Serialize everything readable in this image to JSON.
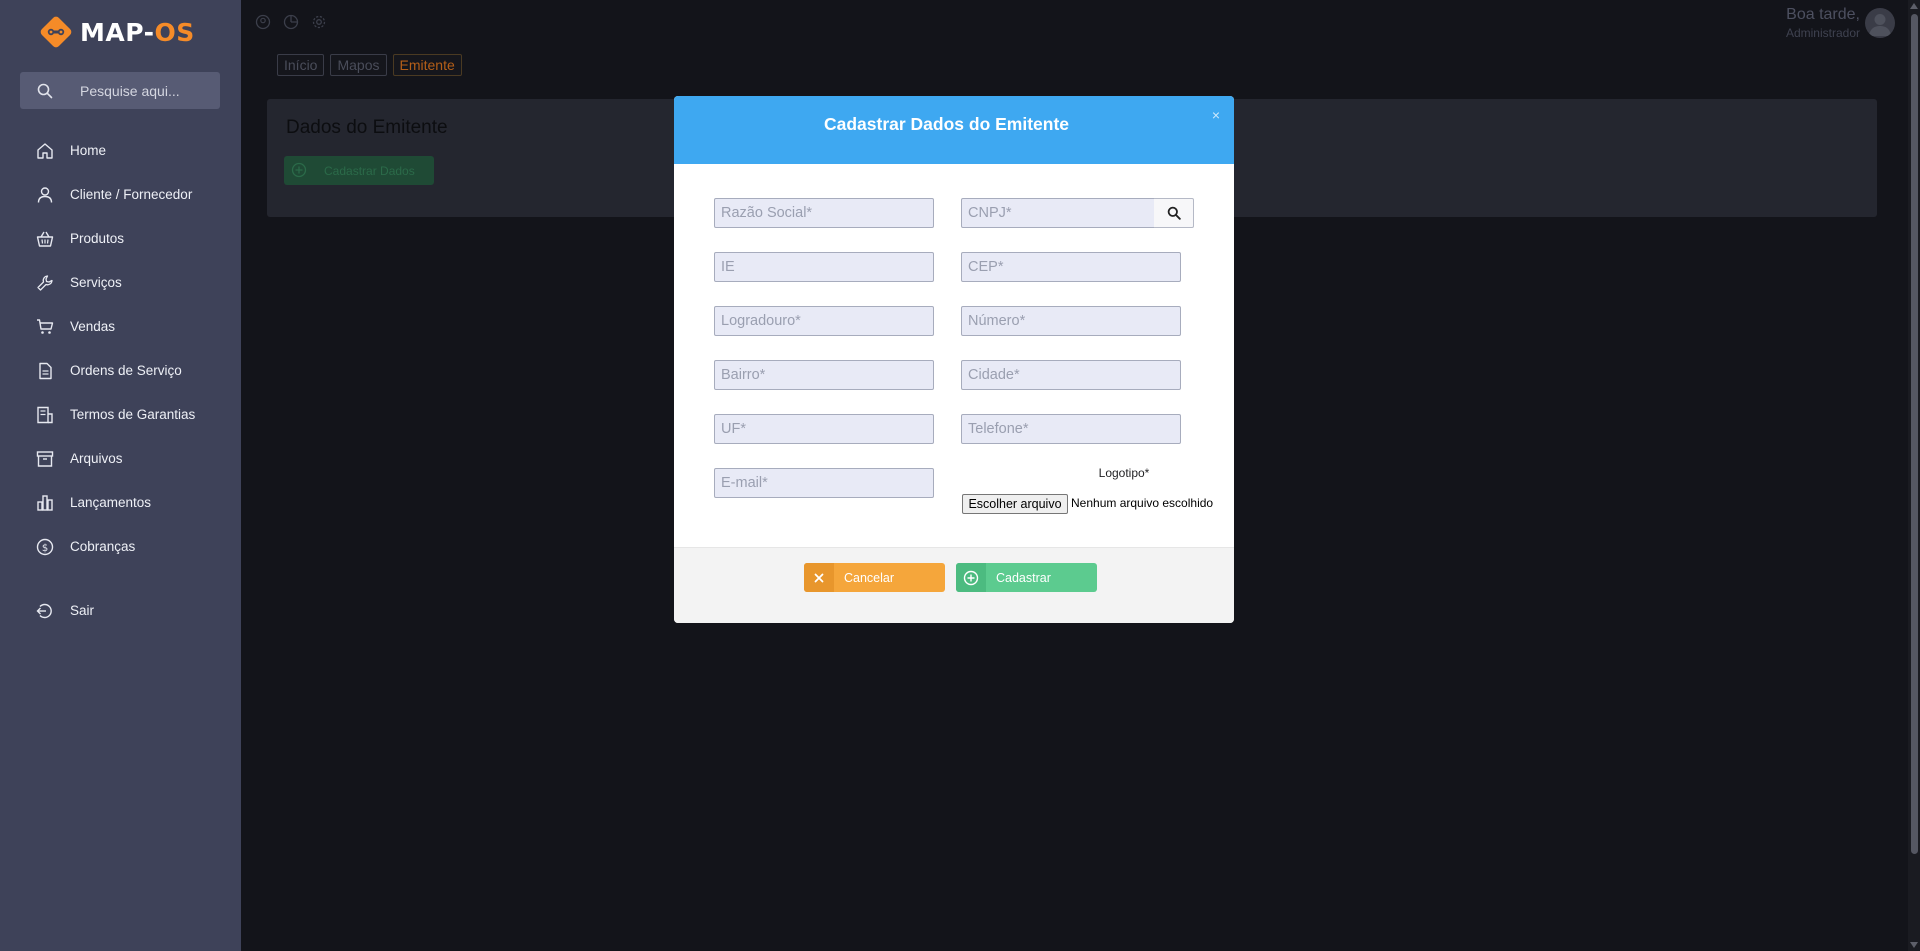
{
  "app": {
    "logo_text_main": "MAP-",
    "logo_text_accent": "OS",
    "search_placeholder": "Pesquise aqui..."
  },
  "sidebar": {
    "items": [
      {
        "label": "Home",
        "icon": "home-icon"
      },
      {
        "label": "Cliente / Fornecedor",
        "icon": "user-icon"
      },
      {
        "label": "Produtos",
        "icon": "basket-icon"
      },
      {
        "label": "Serviços",
        "icon": "wrench-icon"
      },
      {
        "label": "Vendas",
        "icon": "cart-icon"
      },
      {
        "label": "Ordens de Serviço",
        "icon": "document-icon"
      },
      {
        "label": "Termos de Garantias",
        "icon": "receipt-icon"
      },
      {
        "label": "Arquivos",
        "icon": "archive-icon"
      },
      {
        "label": "Lançamentos",
        "icon": "bar-chart-icon"
      },
      {
        "label": "Cobranças",
        "icon": "dollar-circle-icon"
      },
      {
        "label": "Sair",
        "icon": "logout-icon"
      }
    ]
  },
  "header": {
    "greeting": "Boa tarde,",
    "role": "Administrador"
  },
  "breadcrumb": [
    "Início",
    "Mapos",
    "Emitente"
  ],
  "panel": {
    "title": "Dados do Emitente",
    "button_label": "Cadastrar Dados"
  },
  "modal": {
    "title": "Cadastrar Dados do Emitente",
    "close": "×",
    "fields": {
      "razao_social": "Razão Social*",
      "cnpj": "CNPJ*",
      "ie": "IE",
      "cep": "CEP*",
      "logradouro": "Logradouro*",
      "numero": "Número*",
      "bairro": "Bairro*",
      "cidade": "Cidade*",
      "uf": "UF*",
      "telefone": "Telefone*",
      "email": "E-mail*"
    },
    "logo_label": "Logotipo*",
    "file_button": "Escolher arquivo",
    "file_status": "Nenhum arquivo escolhido",
    "cancel_label": "Cancelar",
    "submit_label": "Cadastrar"
  },
  "colors": {
    "sidebar": "#3e4259",
    "brand_orange": "#f58b28",
    "modal_header": "#3ea8f1",
    "cancel": "#f5a63b",
    "submit": "#5ccb8f"
  }
}
